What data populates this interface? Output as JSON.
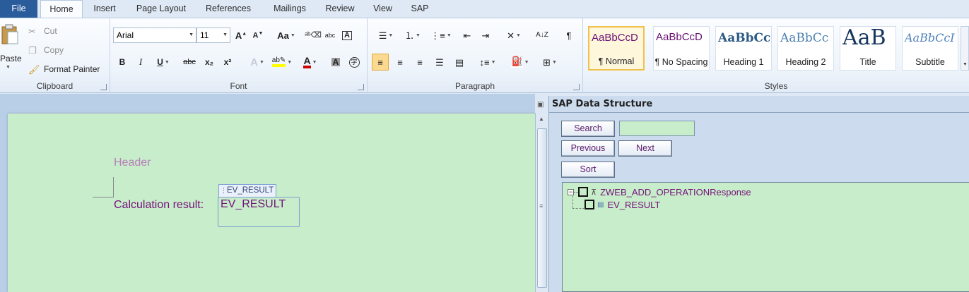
{
  "tabs": {
    "file": "File",
    "home": "Home",
    "insert": "Insert",
    "page_layout": "Page Layout",
    "references": "References",
    "mailings": "Mailings",
    "review": "Review",
    "view": "View",
    "sap": "SAP"
  },
  "clipboard": {
    "paste": "Paste",
    "cut": "Cut",
    "copy": "Copy",
    "format_painter": "Format Painter",
    "label": "Clipboard"
  },
  "font": {
    "family": "Arial",
    "size": "11",
    "label": "Font",
    "aa": "Aa",
    "bold": "B",
    "italic": "I",
    "underline": "U",
    "strike": "abc",
    "sub": "x₂",
    "sup": "x²",
    "font_color": "#d00000",
    "highlight_color": "#ffff00"
  },
  "paragraph": {
    "label": "Paragraph"
  },
  "styles": {
    "label": "Styles",
    "items": [
      {
        "preview": "AaBbCcD",
        "name": "¶ Normal"
      },
      {
        "preview": "AaBbCcD",
        "name": "¶ No Spacing"
      },
      {
        "preview": "AaBbCc",
        "name": "Heading 1"
      },
      {
        "preview": "AaBbCc",
        "name": "Heading 2"
      },
      {
        "preview": "AaB",
        "name": "Title"
      },
      {
        "preview": "AaBbCcI",
        "name": "Subtitle"
      }
    ]
  },
  "document": {
    "header": "Header",
    "calc_label": "Calculation result:",
    "field_tag": "EV_RESULT",
    "field_value": "EV_RESULT"
  },
  "sap_pane": {
    "title": "SAP Data Structure",
    "search": "Search",
    "search_value": "",
    "previous": "Previous",
    "next": "Next",
    "sort": "Sort",
    "tree": {
      "root": "ZWEB_ADD_OPERATIONResponse",
      "child": "EV_RESULT"
    }
  }
}
